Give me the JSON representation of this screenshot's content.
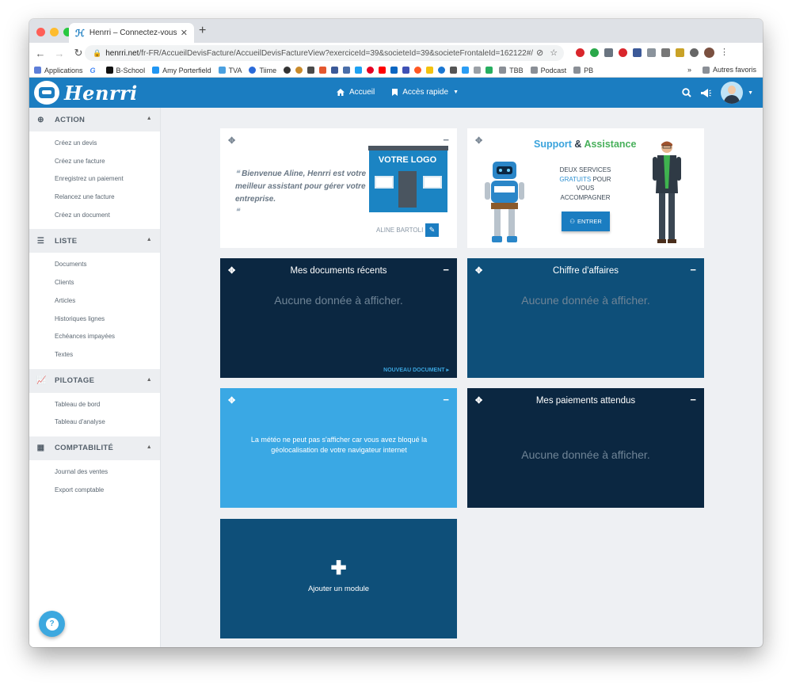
{
  "browser": {
    "tab_title": "Henrri – Connectez-vous à votre...",
    "tab_close": "✕",
    "new_tab": "+",
    "url_host": "henrri.net",
    "url_path": "/fr-FR/AccueilDevisFacture/AccueilDevisFactureView?exerciceId=39&societeId=39&societeFrontaleId=162122#/",
    "bookmarks": [
      "Applications",
      "B-School",
      "Amy Porterfield",
      "TVA",
      "Tiime"
    ],
    "bookmarks_right": [
      "TBB",
      "Podcast",
      "PB"
    ],
    "more": "»",
    "other_bookmarks": "Autres favoris"
  },
  "app": {
    "logo": "Henrri",
    "nav": [
      {
        "icon": "home-icon",
        "label": "Accueil"
      },
      {
        "icon": "bookmark-icon",
        "label": "Accès rapide"
      }
    ]
  },
  "sidebar": {
    "sections": [
      {
        "icon": "plus-circle-icon",
        "label": "ACTION",
        "items": [
          "Créez un devis",
          "Créez une facture",
          "Enregistrez un paiement",
          "Relancez une facture",
          "Créez un document"
        ]
      },
      {
        "icon": "list-icon",
        "label": "LISTE",
        "items": [
          "Documents",
          "Clients",
          "Articles",
          "Historiques lignes",
          "Echéances impayées",
          "Textes"
        ]
      },
      {
        "icon": "chart-icon",
        "label": "PILOTAGE",
        "items": [
          "Tableau de bord",
          "Tableau d'analyse"
        ]
      },
      {
        "icon": "calculator-icon",
        "label": "COMPTABILITÉ",
        "items": [
          "Journal des ventes",
          "Export comptable"
        ]
      }
    ]
  },
  "welcome": {
    "quote": "Bienvenue Aline, Henrri est votre meilleur assistant pour gérer votre entreprise.",
    "logo_sign": "VOTRE LOGO",
    "user": "ALINE BARTOLI"
  },
  "support": {
    "title_a": "Support",
    "title_b": " & ",
    "title_c": "Assistance",
    "line1": "DEUX SERVICES",
    "line2_highlight": "GRATUITS",
    "line2_rest": " POUR VOUS ACCOMPAGNER",
    "button": "ENTRER"
  },
  "widgets": {
    "recent_title": "Mes documents récents",
    "empty": "Aucune donnée à afficher.",
    "new_document": "NOUVEAU DOCUMENT ▸",
    "ca_title": "Chiffre d'affaires",
    "weather_message": "La météo ne peut pas s'afficher car vous avez bloqué la géolocalisation de votre navigateur internet",
    "payments_title": "Mes paiements attendus",
    "add_module": "Ajouter un module"
  },
  "colors": {
    "brand_blue": "#1b7dc1",
    "navy": "#0b2741",
    "teal_blue": "#0e4f79",
    "sky": "#3aa8e4",
    "green": "#48b05b"
  }
}
